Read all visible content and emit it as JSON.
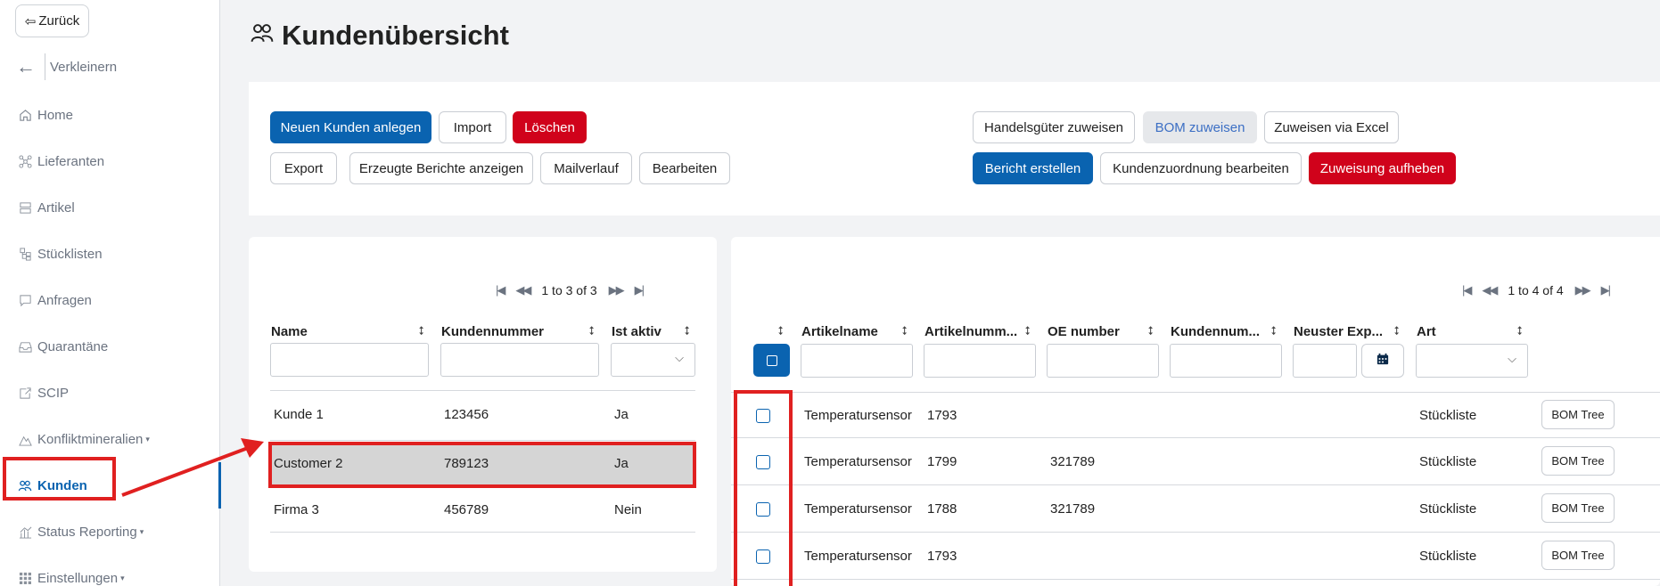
{
  "sidebar": {
    "back_label": "Zurück",
    "collapse_label": "Verkleinern",
    "items": [
      {
        "label": "Home",
        "icon": "home-icon"
      },
      {
        "label": "Lieferanten",
        "icon": "network-icon"
      },
      {
        "label": "Artikel",
        "icon": "server-icon"
      },
      {
        "label": "Stücklisten",
        "icon": "tree-icon"
      },
      {
        "label": "Anfragen",
        "icon": "chat-icon"
      },
      {
        "label": "Quarantäne",
        "icon": "inbox-icon"
      },
      {
        "label": "SCIP",
        "icon": "export-icon"
      },
      {
        "label": "Konfliktmineralien",
        "icon": "mineral-icon",
        "caret": "▾"
      },
      {
        "label": "Kunden",
        "icon": "users-icon",
        "active": true
      },
      {
        "label": "Status Reporting",
        "icon": "chart-icon",
        "caret": "▾"
      },
      {
        "label": "Einstellungen",
        "icon": "grid-icon",
        "caret": "▾"
      }
    ]
  },
  "page": {
    "title": "Kundenübersicht"
  },
  "toolbar": {
    "new_customer": "Neuen Kunden anlegen",
    "import": "Import",
    "delete": "Löschen",
    "export": "Export",
    "reports": "Erzeugte Berichte anzeigen",
    "mail_history": "Mailverlauf",
    "edit": "Bearbeiten",
    "assign_goods": "Handelsgüter zuweisen",
    "assign_bom": "BOM zuweisen",
    "assign_excel": "Zuweisen via Excel",
    "create_report": "Bericht erstellen",
    "edit_assignment": "Kundenzuordnung bearbeiten",
    "remove_assignment": "Zuweisung aufheben"
  },
  "customers": {
    "pager_text": "1 to 3 of 3",
    "columns": [
      "Name",
      "Kundennummer",
      "Ist aktiv"
    ],
    "rows": [
      {
        "name": "Kunde 1",
        "number": "123456",
        "active": "Ja"
      },
      {
        "name": "Customer 2",
        "number": "789123",
        "active": "Ja"
      },
      {
        "name": "Firma 3",
        "number": "456789",
        "active": "Nein"
      }
    ]
  },
  "articles": {
    "pager_text": "1 to 4 of 4",
    "columns": [
      "Artikelname",
      "Artikelnumm...",
      "OE number",
      "Kundennum...",
      "Neuster Exp...",
      "Art"
    ],
    "bom_label": "BOM Tree",
    "rows": [
      {
        "name": "Temperatursensor",
        "number": "1793",
        "oe": "",
        "type": "Stückliste"
      },
      {
        "name": "Temperatursensor",
        "number": "1799",
        "oe": "321789",
        "type": "Stückliste"
      },
      {
        "name": "Temperatursensor",
        "number": "1788",
        "oe": "321789",
        "type": "Stückliste"
      },
      {
        "name": "Temperatursensor",
        "number": "1793",
        "oe": "",
        "type": "Stückliste"
      }
    ]
  },
  "colors": {
    "primary": "#0a63b0",
    "danger": "#d0021b",
    "annotation": "#e02020"
  }
}
